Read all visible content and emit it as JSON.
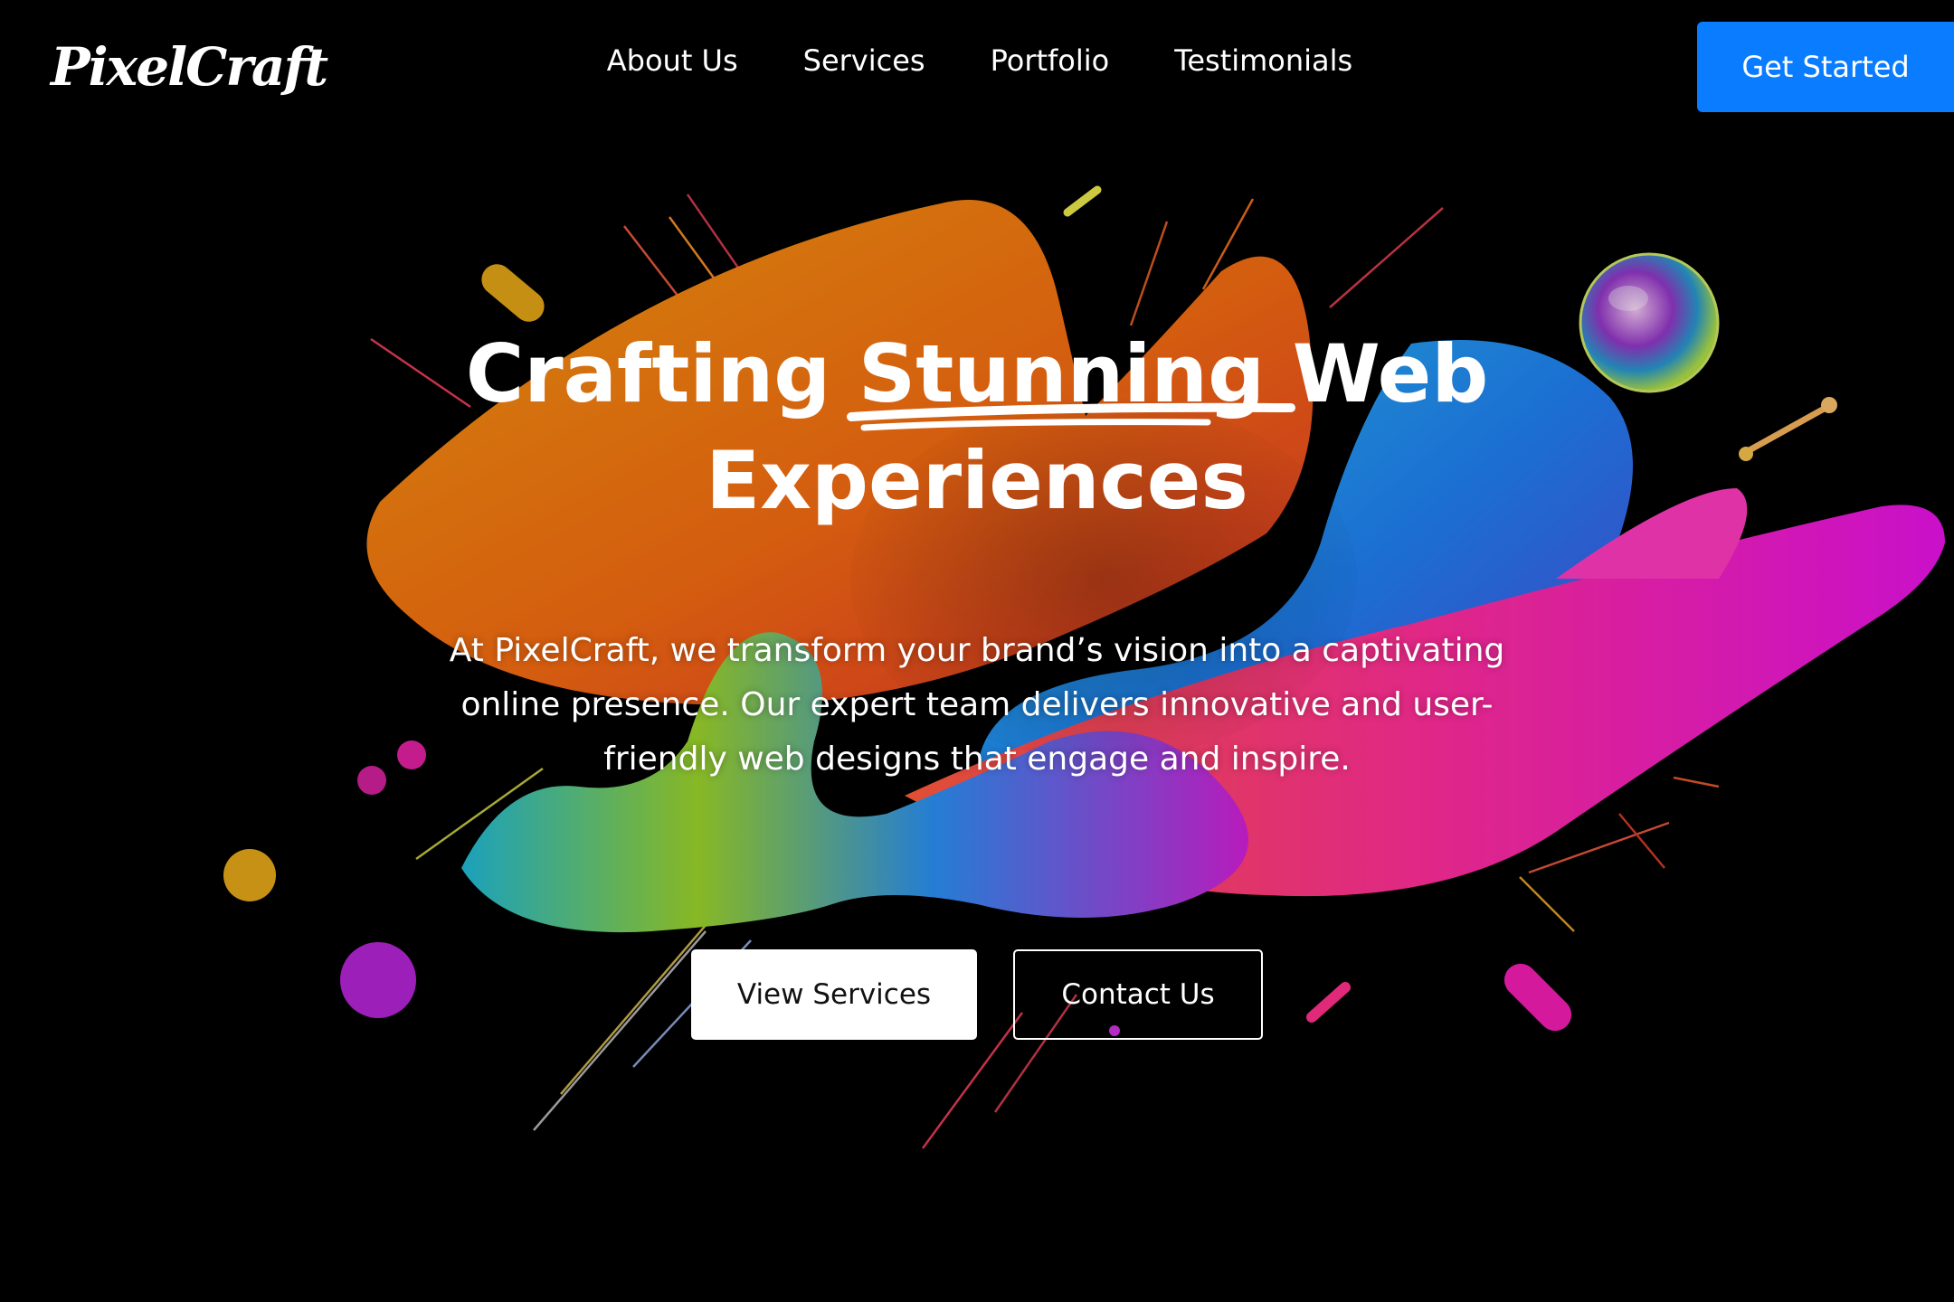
{
  "brand": {
    "logo_text": "PixelCraft"
  },
  "nav": {
    "items": [
      {
        "label": "About Us"
      },
      {
        "label": "Services"
      },
      {
        "label": "Portfolio"
      },
      {
        "label": "Testimonials"
      }
    ],
    "cta_label": "Get Started"
  },
  "hero": {
    "headline_before": "Crafting",
    "headline_highlight": "Stunning",
    "headline_after": "Web",
    "headline_line2": "Experiences",
    "subtitle": "At PixelCraft, we transform your brand’s vision into a captivating online presence. Our expert team delivers innovative and user-friendly web designs that engage and inspire.",
    "primary_button": "View Services",
    "secondary_button": "Contact Us"
  },
  "colors": {
    "background": "#000000",
    "accent": "#0a7cff",
    "text": "#ffffff"
  },
  "icons": {
    "hero_art": "abstract-fluid-shapes",
    "headline_underline": "brush-underline"
  }
}
